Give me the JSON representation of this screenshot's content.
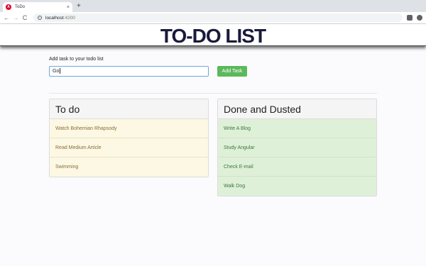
{
  "browser": {
    "tab_title": "ToDo",
    "tab_close": "×",
    "new_tab": "+",
    "url_host": "localhost",
    "url_port": ":4200",
    "back": "←",
    "forward": "→",
    "reload": "C"
  },
  "app": {
    "title": "TO-DO LIST"
  },
  "form": {
    "label": "Add task to your todo list",
    "input_value": "Go",
    "button_label": "Add Task"
  },
  "todo": {
    "heading": "To do",
    "items": [
      "Watch Bohemian Rhapsody",
      "Read Medium Article",
      "Swimming"
    ]
  },
  "done": {
    "heading": "Done and Dusted",
    "items": [
      "Write A Blog",
      "Study Angular",
      "Check E-mail",
      "Walk Dog"
    ]
  },
  "colors": {
    "todo_item_bg": "#fcf8e3",
    "done_item_bg": "#dff0d8",
    "add_button": "#5cb85c",
    "title_color": "#1a1a3c"
  }
}
